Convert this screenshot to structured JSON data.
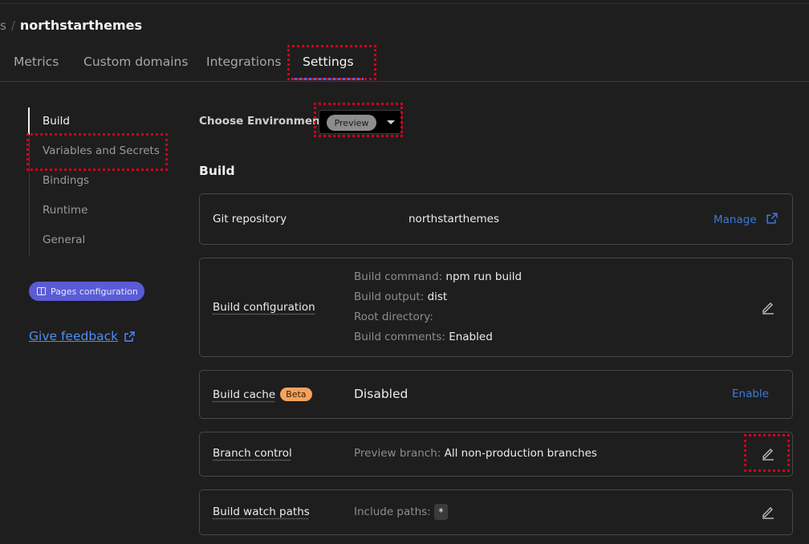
{
  "breadcrumb": {
    "prev": "s",
    "separator": "/",
    "project": "northstarthemes"
  },
  "tabs": [
    {
      "label": "Metrics"
    },
    {
      "label": "Custom domains"
    },
    {
      "label": "Integrations"
    },
    {
      "label": "Settings"
    }
  ],
  "sidebar": {
    "items": [
      {
        "label": "Build"
      },
      {
        "label": "Variables and Secrets"
      },
      {
        "label": "Bindings"
      },
      {
        "label": "Runtime"
      },
      {
        "label": "General"
      }
    ],
    "pages_config": "Pages configuration",
    "feedback": "Give feedback"
  },
  "environment": {
    "label": "Choose Environment:",
    "selected": "Preview"
  },
  "build": {
    "title": "Build",
    "git": {
      "label": "Git repository",
      "value": "northstarthemes",
      "action": "Manage"
    },
    "config": {
      "label": "Build configuration",
      "command_key": "Build command:",
      "command_val": "npm run build",
      "output_key": "Build output:",
      "output_val": "dist",
      "root_key": "Root directory:",
      "root_val": "",
      "comments_key": "Build comments:",
      "comments_val": "Enabled"
    },
    "cache": {
      "label": "Build cache",
      "badge": "Beta",
      "value": "Disabled",
      "action": "Enable"
    },
    "branch": {
      "label": "Branch control",
      "key": "Preview branch:",
      "value": "All non-production branches"
    },
    "watch": {
      "label": "Build watch paths",
      "key": "Include paths:",
      "value": "*"
    }
  },
  "colors": {
    "accent": "#3b6ff0",
    "link": "#4e8ef7",
    "badge": "#5b5bd6",
    "beta": "#f5a25d",
    "highlight": "#d0021b"
  }
}
